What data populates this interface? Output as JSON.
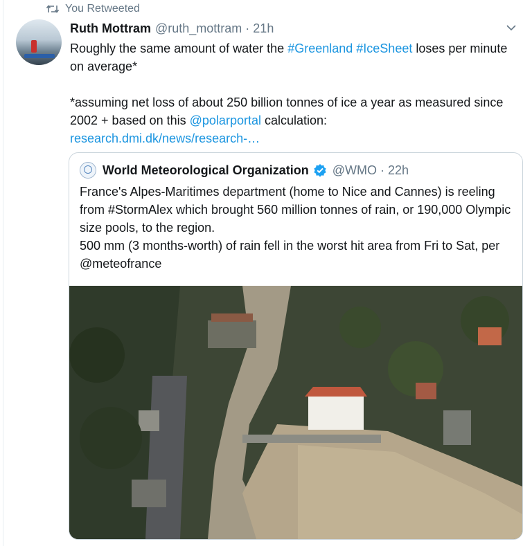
{
  "retweet": {
    "label": "You Retweeted",
    "icon": "retweet-icon"
  },
  "tweet": {
    "name": "Ruth Mottram",
    "handle": "@ruth_mottram",
    "separator": "·",
    "time": "21h",
    "line1_a": "Roughly the same amount of water the ",
    "hashtag1": "#Greenland",
    "space": " ",
    "hashtag2": "#IceSheet",
    "line1_b": " loses per minute on average*",
    "note_a": "*assuming net loss of about 250 billion tonnes of ice a year as measured since 2002 + based on this ",
    "mention": "@polarportal",
    "note_b": " calculation:",
    "url": "research.dmi.dk/news/research-…"
  },
  "quoted": {
    "name": "World Meteorological Organization",
    "handle": "@WMO",
    "separator": "·",
    "time": "22h",
    "p1": "France's Alpes-Maritimes department (home to Nice and Cannes) is reeling from #StormAlex which brought 560 million tonnes of rain, or 190,000 Olympic size pools, to the region.",
    "p2": "500 mm (3 months-worth) of rain fell in the worst hit area from Fri to Sat, per @meteofrance"
  },
  "colors": {
    "link": "#1b95e0",
    "muted": "#657786",
    "text": "#14171a",
    "border": "#ccd6dd",
    "verified": "#1da1f2"
  }
}
